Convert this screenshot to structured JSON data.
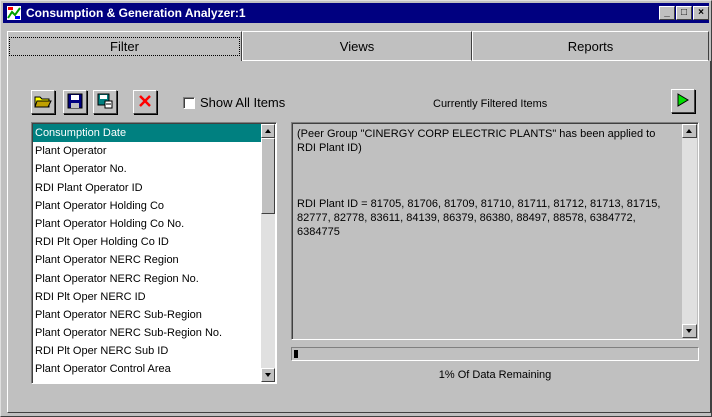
{
  "window": {
    "title": "Consumption & Generation Analyzer:1",
    "controls": {
      "minimize": "_",
      "maximize": "□",
      "close": "×"
    }
  },
  "tabs": [
    {
      "label": "Filter",
      "active": true
    },
    {
      "label": "Views",
      "active": false
    },
    {
      "label": "Reports",
      "active": false
    }
  ],
  "toolbar": {
    "buttons": [
      {
        "icon": "open-folder-icon"
      },
      {
        "icon": "save-icon"
      },
      {
        "icon": "save-as-icon"
      },
      {
        "icon": "delete-icon"
      }
    ],
    "show_all_items_label": "Show All Items",
    "show_all_items_checked": false,
    "run_icon": "play-icon"
  },
  "filter_panel": {
    "heading": "Currently Filtered Items",
    "lines": [
      "(Peer Group \"CINERGY CORP ELECTRIC PLANTS\" has been applied to RDI Plant ID)",
      "RDI Plant ID = 81705, 81706, 81709, 81710, 81711, 81712, 81713, 81715, 82777, 82778, 83611, 84139, 86379, 86380, 88497, 88578, 6384772, 6384775"
    ]
  },
  "field_list": {
    "selected_index": 0,
    "items": [
      "Consumption Date",
      "Plant Operator",
      "Plant Operator No.",
      "RDI Plant Operator ID",
      "Plant Operator Holding Co",
      "Plant Operator Holding Co No.",
      "RDI Plt Oper Holding Co ID",
      "Plant Operator NERC Region",
      "Plant Operator NERC Region No.",
      "RDI Plt Oper NERC ID",
      "Plant Operator NERC Sub-Region",
      "Plant Operator NERC Sub-Region No.",
      "RDI Plt Oper NERC Sub ID",
      "Plant Operator Control Area"
    ]
  },
  "data_remaining": {
    "percent": 1,
    "label": "1% Of Data Remaining"
  },
  "colors": {
    "titlebar": "#000080",
    "selection": "#008080",
    "face": "#c0c0c0"
  }
}
